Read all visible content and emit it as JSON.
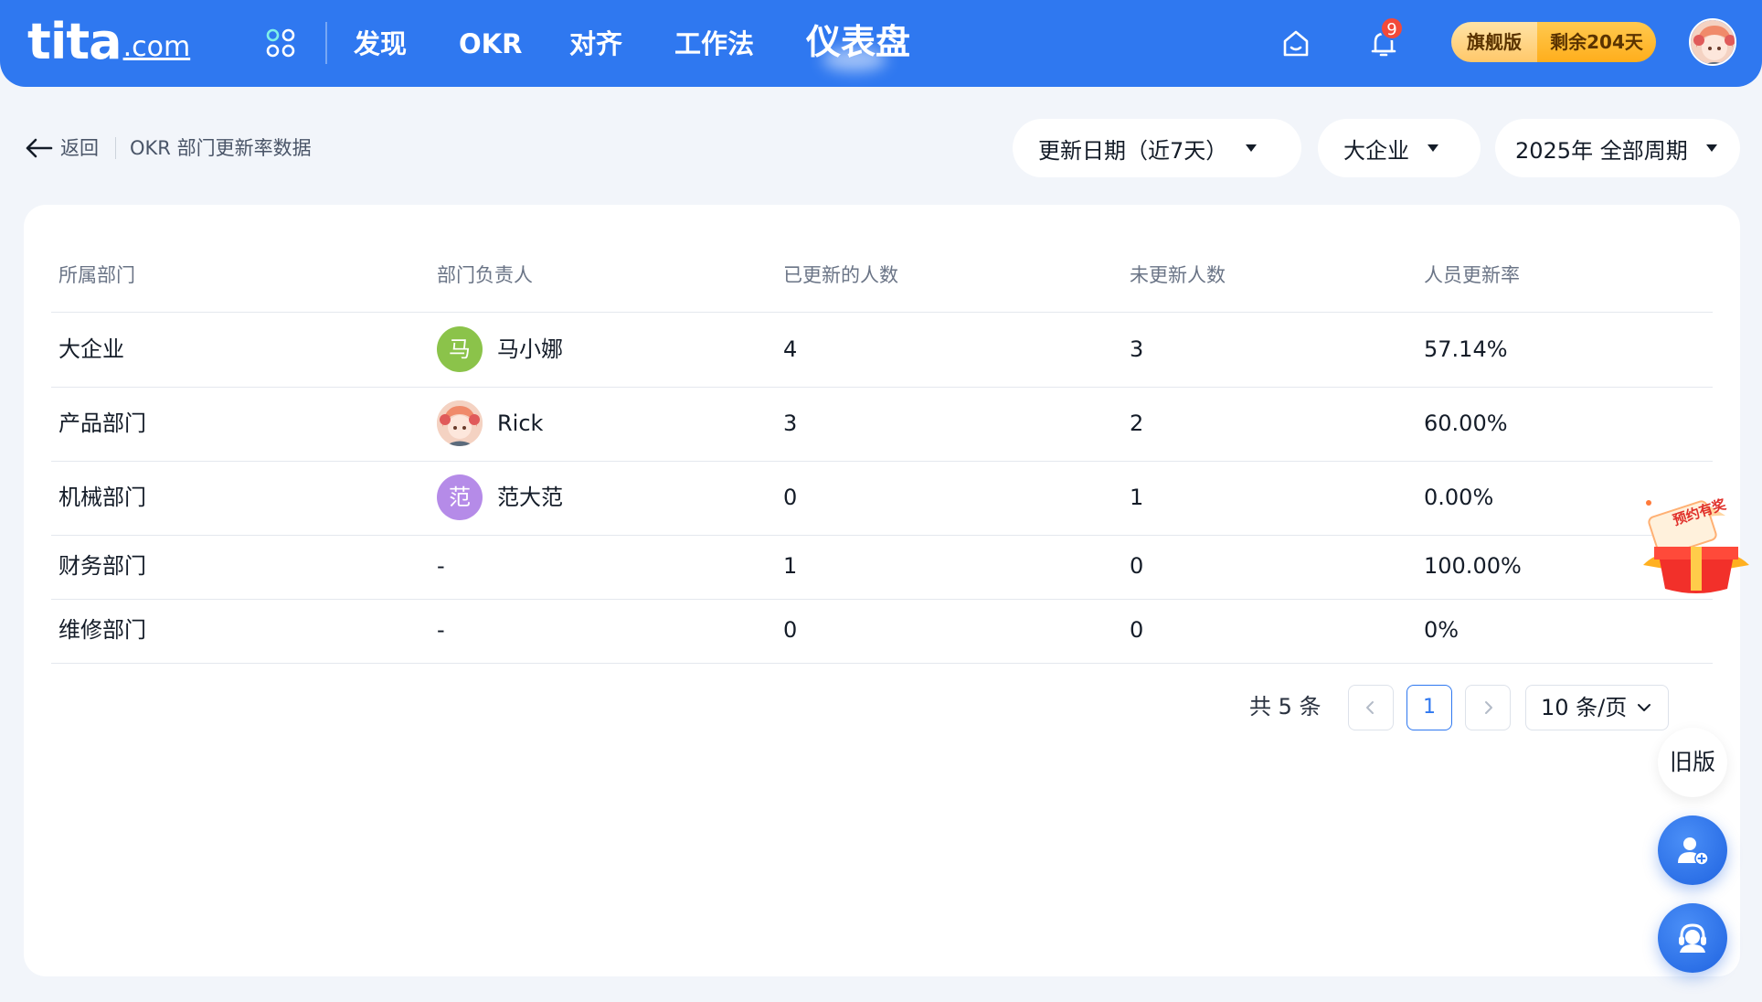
{
  "header": {
    "logo_main": "tita",
    "logo_suffix": ".com",
    "nav": [
      "发现",
      "OKR",
      "对齐",
      "工作法",
      "仪表盘"
    ],
    "active_nav": "仪表盘",
    "notification_count": "9",
    "edition_label": "旗舰版",
    "edition_remaining": "剩余204天"
  },
  "breadcrumb": {
    "back_label": "返回",
    "title": "OKR 部门更新率数据"
  },
  "filters": {
    "date_range": "更新日期（近7天）",
    "department": "大企业",
    "period": "2025年 全部周期"
  },
  "table": {
    "columns": [
      "所属部门",
      "部门负责人",
      "已更新的人数",
      "未更新人数",
      "人员更新率"
    ],
    "rows": [
      {
        "department": "大企业",
        "owner": "马小娜",
        "avatar_text": "马",
        "avatar_color": "#8bc34a",
        "updated": "4",
        "not_updated": "3",
        "rate": "57.14%"
      },
      {
        "department": "产品部门",
        "owner": "Rick",
        "avatar_text": "",
        "avatar_color": "",
        "updated": "3",
        "not_updated": "2",
        "rate": "60.00%"
      },
      {
        "department": "机械部门",
        "owner": "范大范",
        "avatar_text": "范",
        "avatar_color": "#b58be8",
        "updated": "0",
        "not_updated": "1",
        "rate": "0.00%"
      },
      {
        "department": "财务部门",
        "owner": "-",
        "avatar_text": "",
        "avatar_color": "",
        "updated": "1",
        "not_updated": "0",
        "rate": "100.00%"
      },
      {
        "department": "维修部门",
        "owner": "-",
        "avatar_text": "",
        "avatar_color": "",
        "updated": "0",
        "not_updated": "0",
        "rate": "0%"
      }
    ]
  },
  "pagination": {
    "total_text": "共 5 条",
    "current_page": "1",
    "page_size": "10 条/页"
  },
  "floating": {
    "promo_text": "预约有奖",
    "old_version_label": "旧版"
  },
  "colors": {
    "brand": "#2f78f0",
    "badge": "#f24a3a"
  }
}
